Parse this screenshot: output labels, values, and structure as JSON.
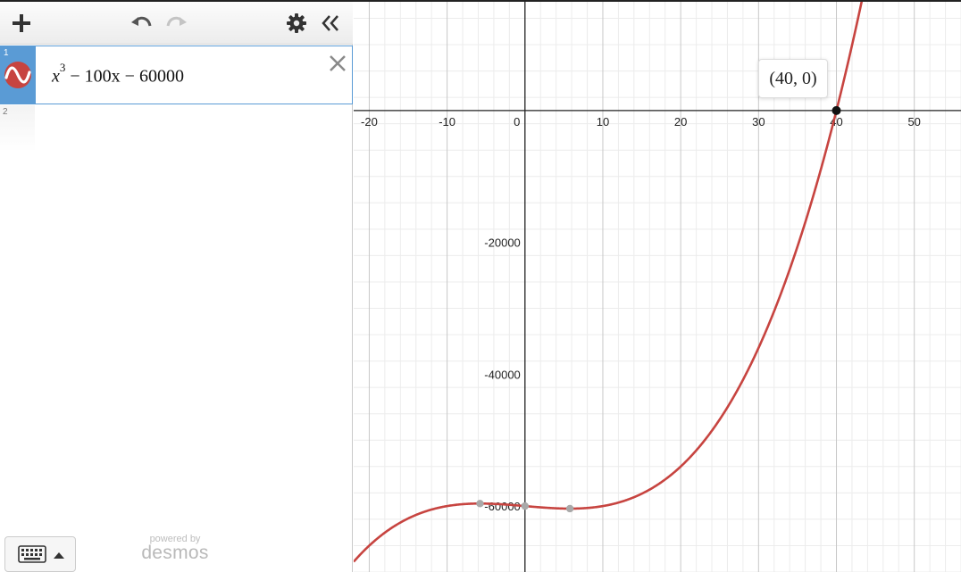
{
  "toolbar": {
    "add_icon": "plus-icon",
    "undo_icon": "undo-icon",
    "redo_icon": "redo-icon",
    "settings_icon": "gear-icon",
    "collapse_icon": "double-chevron-left-icon"
  },
  "expressions": [
    {
      "index": "1",
      "icon": "function-graph-icon",
      "color": "#c74440",
      "latex_parts": {
        "base": "x",
        "exponent": "3",
        "rest": " − 100x − 60000"
      }
    },
    {
      "index": "2",
      "latex_parts": null
    }
  ],
  "footer": {
    "keyboard_icon": "keyboard-icon",
    "powered_by": "powered by",
    "brand": "desmos"
  },
  "graph": {
    "curve_color": "#c74440",
    "point_label": "(40, 0)",
    "x_ticks": [
      "-20",
      "-10",
      "0",
      "10",
      "20",
      "30",
      "40",
      "50"
    ],
    "y_ticks": [
      "-20000",
      "-40000",
      "-60000"
    ]
  },
  "chart_data": {
    "type": "line",
    "function": "x^3 - 100x - 60000",
    "xlim": [
      -22,
      56
    ],
    "ylim": [
      -70000,
      16500
    ],
    "grid": true,
    "highlighted_point": [
      40,
      0
    ],
    "series": [
      {
        "name": "x^3 - 100x - 60000",
        "color": "#c74440"
      }
    ]
  }
}
